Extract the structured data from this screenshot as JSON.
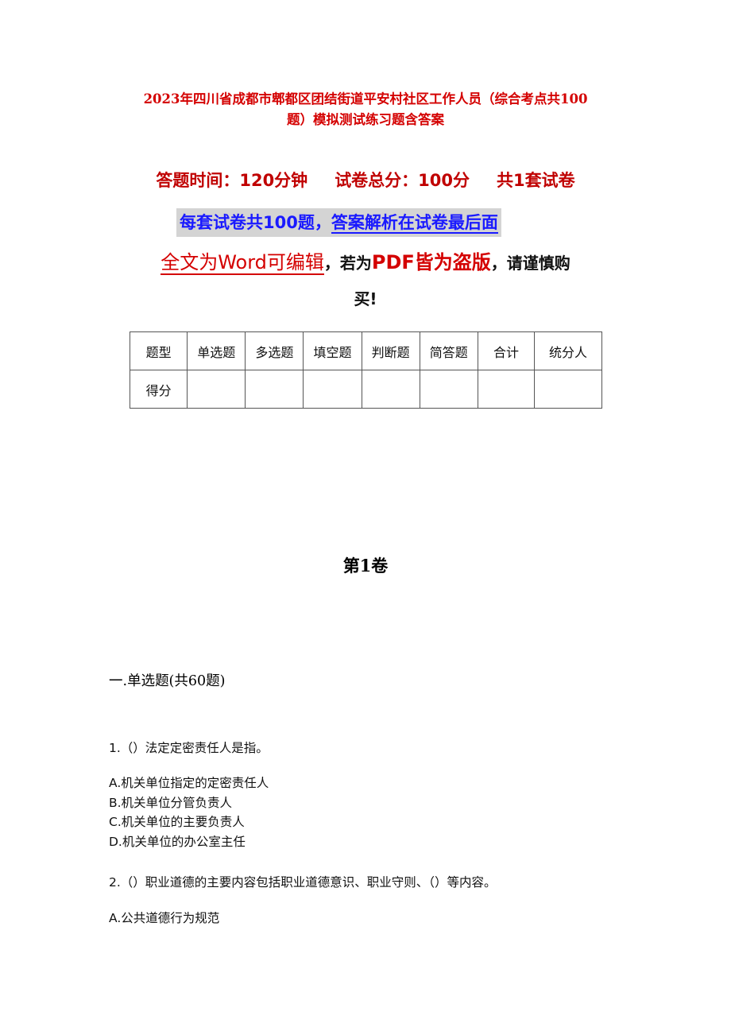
{
  "document": {
    "title_line1": "2023年四川省成都市郫都区团结街道平安村社区工作人员（综合考点共100",
    "title_line2": "题）模拟测试练习题含答案",
    "meta": {
      "time": "答题时间：120分钟",
      "total_score": "试卷总分：100分",
      "sets": "共1套试卷"
    },
    "notice": {
      "part1": "每套试卷共100题，",
      "part2": "答案解析在试卷最后面"
    },
    "warning": {
      "part1": "全文为Word可编辑",
      "comma1": "，",
      "part2": "若为",
      "part3": "PDF皆为盗版",
      "part4": "，请谨慎购",
      "line2": "买!"
    },
    "score_table": {
      "headers": [
        "题型",
        "单选题",
        "多选题",
        "填空题",
        "判断题",
        "简答题",
        "合计",
        "统分人"
      ],
      "row": [
        "得分",
        "",
        "",
        "",
        "",
        "",
        "",
        ""
      ]
    },
    "volume_title": "第1卷",
    "section_title": "一.单选题(共60题)",
    "questions": [
      {
        "stem": "1.（）法定定密责任人是指。",
        "options": [
          "A.机关单位指定的定密责任人",
          "B.机关单位分管负责人",
          "C.机关单位的主要负责人",
          "D.机关单位的办公室主任"
        ]
      },
      {
        "stem": "2.（）职业道德的主要内容包括职业道德意识、职业守则、（）等内容。",
        "options": [
          "A.公共道德行为规范"
        ]
      }
    ]
  }
}
